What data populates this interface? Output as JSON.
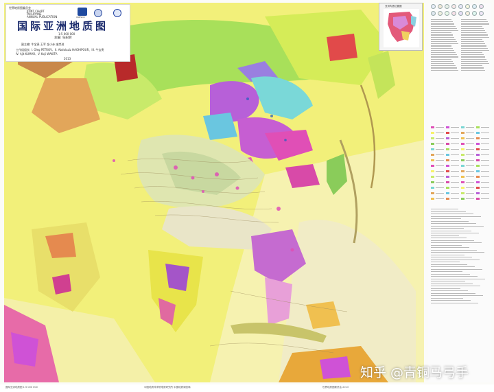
{
  "title_block": {
    "series_line": "世界地质图委员会",
    "org_line_1": "JOINT CHART",
    "org_line_2": "PHILIPPINE",
    "org_line_3": "ANNUAL PUBLICATION",
    "title": "国际亚洲地质图",
    "scale": "1:5 000 000",
    "chief_editor": "主编: 任纪舜",
    "deputy_editors": "副主编: 牛宝贵  王军  金小赤  庞崇进",
    "working_group_1": "工作组组长: I. Oleg PETROV、II. Abdolaziz HAGHIPOUR、III. 牛宝贵",
    "working_group_2": "IV. Ajit KUMAR、V. Koji WAKITA",
    "year": "2013",
    "logo_caption": "UNESCO"
  },
  "inset": {
    "title": "亚洲构造位置图"
  },
  "watermark": {
    "text": "知乎 @青铜马弓手"
  },
  "footer": {
    "left_text": "国际亚洲地质图 1:5 000 000",
    "mid_text": "中国地质科学院地质研究所  中国地质调查局",
    "right_text": "世界地质图委员会  2013"
  },
  "colors": {
    "land_base": "#f2f07a",
    "ocean": "#f3f0c8",
    "precambrian_craton": "#cf52d6",
    "paleozoic": "#79d6d3",
    "mesozoic": "#a8e05a",
    "cenozoic": "#f7f26a",
    "volcanic": "#e14a4a",
    "granite": "#e04fb6",
    "title_text": "#1a2a6c"
  },
  "icons": [
    "unesco-logo-icon",
    "cgmw-logo-icon",
    "survey-logo-icon"
  ]
}
